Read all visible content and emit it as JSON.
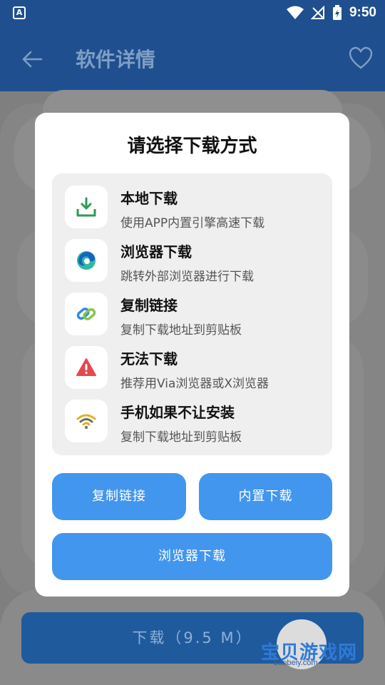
{
  "status_bar": {
    "app_badge": "A",
    "time": "9:50",
    "icons": [
      "wifi-icon",
      "signal-off-icon",
      "battery-charging-icon"
    ]
  },
  "app_bar": {
    "title": "软件详情",
    "back_icon": "arrow-left-icon",
    "favorite_icon": "heart-outline-icon"
  },
  "dialog": {
    "title": "请选择下载方式",
    "options": [
      {
        "title": "本地下载",
        "subtitle": "使用APP内置引擎高速下载",
        "icon": "download-tray-icon"
      },
      {
        "title": "浏览器下载",
        "subtitle": "跳转外部浏览器进行下载",
        "icon": "edge-browser-icon"
      },
      {
        "title": "复制链接",
        "subtitle": "复制下载地址到剪贴板",
        "icon": "link-icon"
      },
      {
        "title": "无法下载",
        "subtitle": "推荐用Via浏览器或X浏览器",
        "icon": "warning-triangle-icon"
      },
      {
        "title": "手机如果不让安装",
        "subtitle": "复制下载地址到剪贴板",
        "icon": "wifi-signal-icon"
      }
    ],
    "buttons": {
      "copy_link": "复制链接",
      "builtin_download": "内置下载",
      "browser_download": "浏览器下载"
    }
  },
  "background": {
    "download_button": "下载（9.5 M）"
  },
  "watermark": {
    "title": "宝贝游戏网",
    "url": "baobeiy.com"
  },
  "colors": {
    "app_bar": "#1f4f8f",
    "button_blue": "#4296ee",
    "download_green": "#2e9b56",
    "warning_red": "#e5484d",
    "wifi_yellow": "#e2b01a"
  }
}
